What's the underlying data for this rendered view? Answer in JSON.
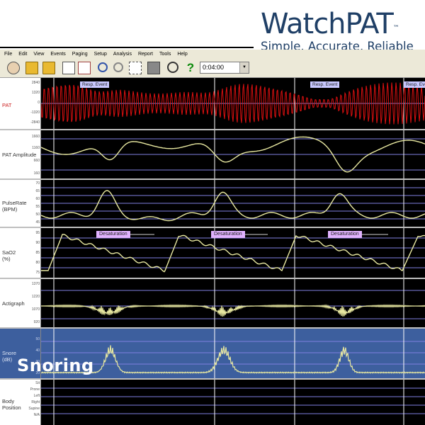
{
  "brand": {
    "name": "WatchPAT",
    "trademark": "™",
    "tagline": "Simple. Accurate. Reliable"
  },
  "menu": [
    "File",
    "Edit",
    "View",
    "Events",
    "Paging",
    "Setup",
    "Analysis",
    "Report",
    "Tools",
    "Help"
  ],
  "toolbar": {
    "help_glyph": "?",
    "time_value": "0:04:00"
  },
  "panels": {
    "pat": {
      "label": "PAT",
      "ticks": [
        "2840",
        "1320",
        "0",
        "-1320",
        "-2840"
      ],
      "event_label": "Resp. Event",
      "color": "#e01010"
    },
    "amplitude": {
      "label": "PAT Amplitude",
      "ticks": [
        "1660",
        "1160",
        "660",
        "160"
      ]
    },
    "pulse": {
      "label_line1": "PulseRate",
      "label_line2": "(BPM)",
      "ticks": [
        "70",
        "65",
        "60",
        "55",
        "50",
        "45"
      ]
    },
    "sao2": {
      "label_line1": "SaO2",
      "label_line2": "(%)",
      "ticks": [
        "95",
        "90",
        "85",
        "80",
        "75"
      ],
      "event_label": "Desaturation"
    },
    "actigraph": {
      "label": "Actigraph",
      "ticks": [
        "1370",
        "1220",
        "1070",
        "920"
      ]
    },
    "snore": {
      "label_line1": "Snore",
      "label_line2": "(dB)",
      "ticks": [
        "50",
        "40",
        "30",
        "20"
      ],
      "overlay_text": "Snoring",
      "background": "#3d5f9e"
    },
    "body": {
      "label_line1": "Body",
      "label_line2": "Position",
      "ticks": [
        "Sit",
        "Prone",
        "Left",
        "Right",
        "Supine",
        "N/A"
      ]
    }
  },
  "colors": {
    "trace": "#e8e8a0",
    "grid": "#7f7fe0",
    "plot_background": "#000000"
  }
}
